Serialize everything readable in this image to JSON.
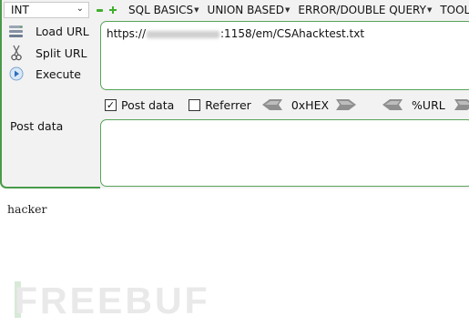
{
  "toolbar": {
    "combo_value": "INT",
    "menus": [
      {
        "label": "SQL BASICS"
      },
      {
        "label": "UNION BASED"
      },
      {
        "label": "ERROR/DOUBLE QUERY"
      },
      {
        "label": "TOOLS"
      }
    ]
  },
  "actions": {
    "load_url": "Load URL",
    "split_url": "Split URL",
    "execute": "Execute"
  },
  "url": {
    "prefix": "https://",
    "suffix": ":1158/em/CSAhacktest.txt"
  },
  "options": {
    "post_data_label": "Post data",
    "post_data_checked": true,
    "referrer_label": "Referrer",
    "referrer_checked": false,
    "hex_label": "0xHEX",
    "url_label": "%URL"
  },
  "post": {
    "label": "Post data",
    "value": ""
  },
  "result": {
    "text": "hacker"
  },
  "watermark": {
    "text": "FREEBUF"
  },
  "colors": {
    "accent_green": "#4a9a4a",
    "icon_green": "#3fae2a"
  }
}
